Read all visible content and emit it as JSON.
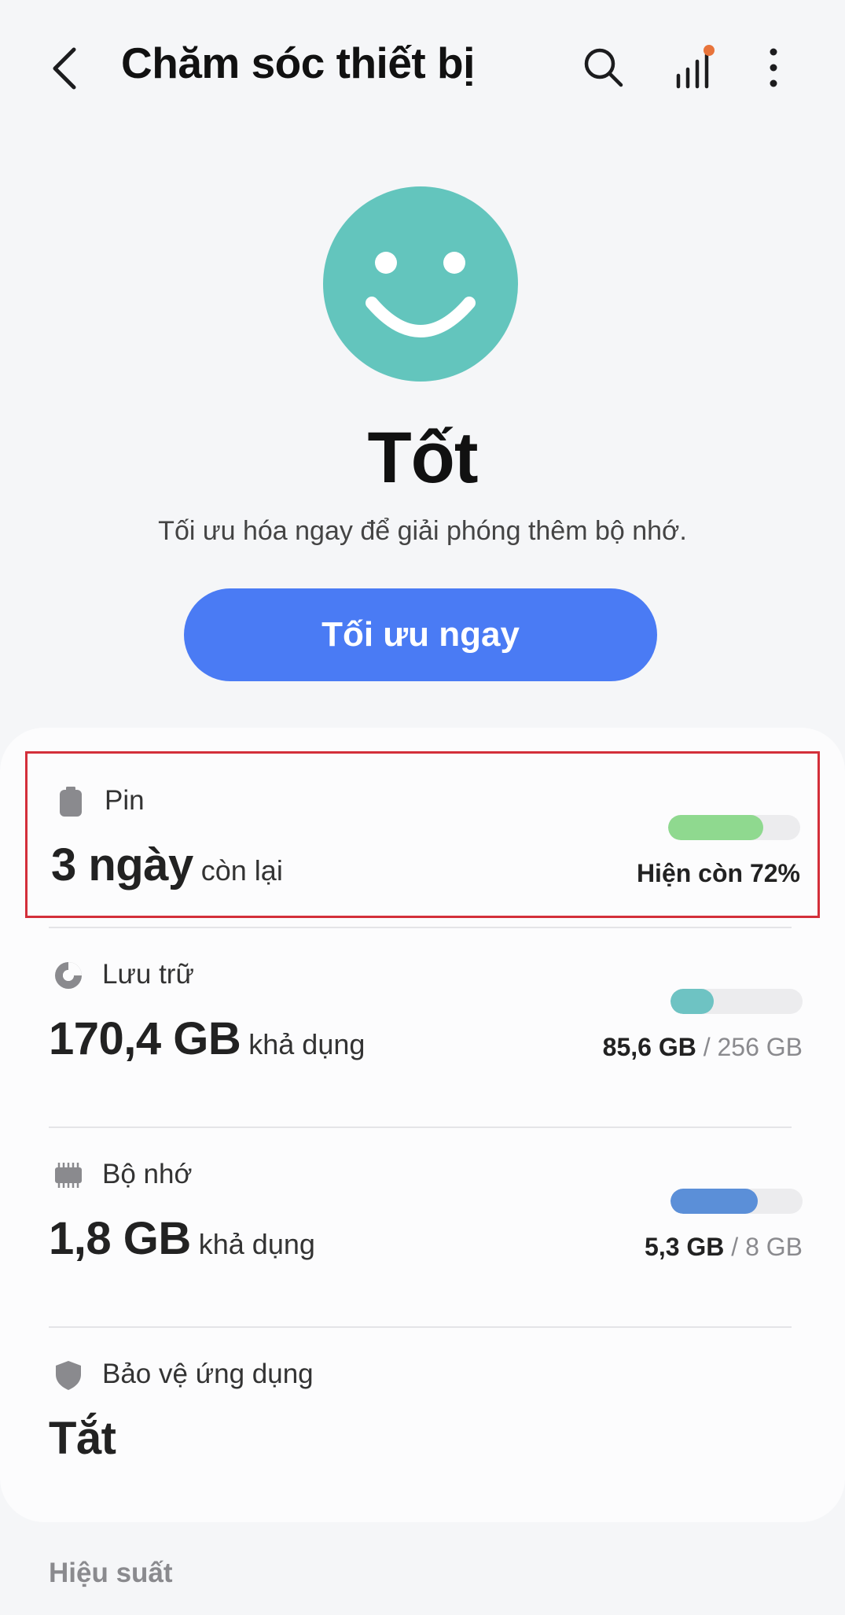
{
  "header": {
    "title": "Chăm sóc thiết bị"
  },
  "status": {
    "title": "Tốt",
    "subtitle": "Tối ưu hóa ngay để giải phóng thêm bộ nhớ.",
    "button_label": "Tối ưu ngay"
  },
  "battery": {
    "label": "Pin",
    "value": "3 ngày",
    "unit": "còn lại",
    "right_text": "Hiện còn 72%",
    "level_percent": 72,
    "color": "#8fd98f"
  },
  "storage": {
    "label": "Lưu trữ",
    "value": "170,4 GB",
    "unit": "khả dụng",
    "used": "85,6 GB",
    "total": "/ 256 GB",
    "level_percent": 33,
    "color": "#6ec3c3"
  },
  "memory": {
    "label": "Bộ nhớ",
    "value": "1,8 GB",
    "unit": "khả dụng",
    "used": "5,3 GB",
    "total": "/ 8 GB",
    "level_percent": 66,
    "color": "#5b8fd8"
  },
  "protection": {
    "label": "Bảo vệ ứng dụng",
    "value": "Tắt"
  },
  "performance": {
    "label": "Hiệu suất"
  },
  "colors": {
    "accent": "#4a7bf4",
    "smiley": "#63c5bd",
    "highlight": "#d32f3a",
    "notification_dot": "#e8743b"
  }
}
